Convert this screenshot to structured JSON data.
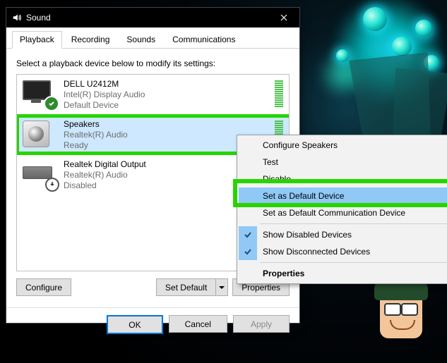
{
  "window": {
    "title": "Sound"
  },
  "tabs": [
    "Playback",
    "Recording",
    "Sounds",
    "Communications"
  ],
  "instruction": "Select a playback device below to modify its settings:",
  "devices": [
    {
      "name": "DELL U2412M",
      "driver": "Intel(R) Display Audio",
      "status": "Default Device"
    },
    {
      "name": "Speakers",
      "driver": "Realtek(R) Audio",
      "status": "Ready"
    },
    {
      "name": "Realtek Digital Output",
      "driver": "Realtek(R) Audio",
      "status": "Disabled"
    }
  ],
  "buttons": {
    "configure": "Configure",
    "set_default": "Set Default",
    "properties": "Properties",
    "ok": "OK",
    "cancel": "Cancel",
    "apply": "Apply"
  },
  "context_menu": {
    "items": [
      "Configure Speakers",
      "Test",
      "Disable",
      "Set as Default Device",
      "Set as Default Communication Device",
      "Show Disabled Devices",
      "Show Disconnected Devices",
      "Properties"
    ]
  }
}
